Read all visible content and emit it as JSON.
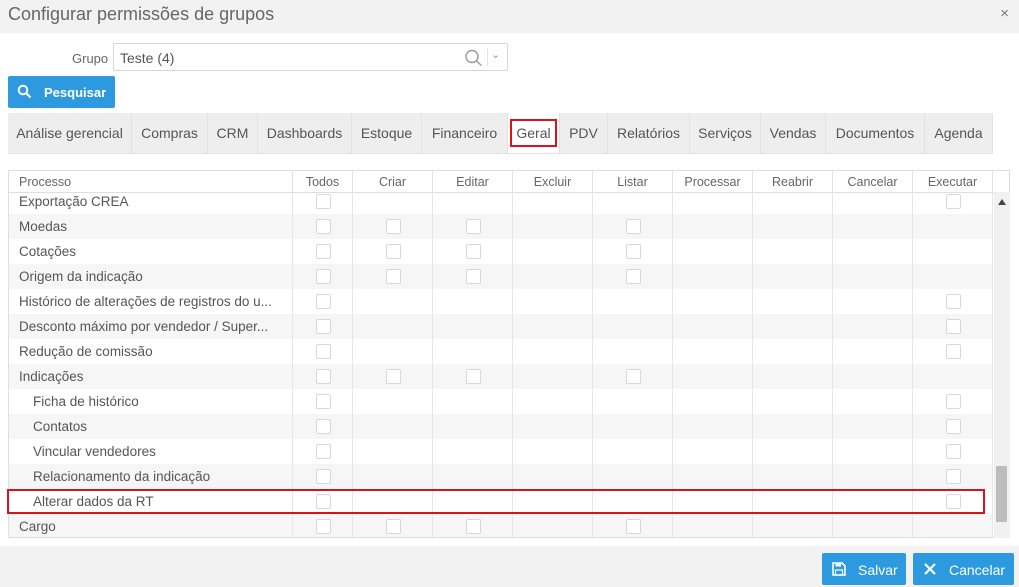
{
  "window": {
    "title": "Configurar permissões de grupos",
    "close_glyph": "×"
  },
  "group": {
    "label": "Grupo",
    "value": "Teste (4)"
  },
  "search_button": {
    "label": "Pesquisar"
  },
  "tabs": [
    {
      "label": "Análise gerencial"
    },
    {
      "label": "Compras"
    },
    {
      "label": "CRM"
    },
    {
      "label": "Dashboards"
    },
    {
      "label": "Estoque"
    },
    {
      "label": "Financeiro"
    },
    {
      "label": "Geral",
      "active": true
    },
    {
      "label": "PDV"
    },
    {
      "label": "Relatórios"
    },
    {
      "label": "Serviços"
    },
    {
      "label": "Vendas"
    },
    {
      "label": "Documentos"
    },
    {
      "label": "Agenda"
    }
  ],
  "table": {
    "columns": [
      "Processo",
      "Todos",
      "Criar",
      "Editar",
      "Excluir",
      "Listar",
      "Processar",
      "Reabrir",
      "Cancelar",
      "Executar"
    ],
    "rows": [
      {
        "name": "Exportação CREA",
        "indent": false,
        "checks": [
          1,
          0,
          0,
          0,
          0,
          0,
          0,
          0,
          1
        ]
      },
      {
        "name": "Moedas",
        "indent": false,
        "checks": [
          1,
          1,
          1,
          0,
          1,
          0,
          0,
          0,
          0
        ]
      },
      {
        "name": "Cotações",
        "indent": false,
        "checks": [
          1,
          1,
          1,
          0,
          1,
          0,
          0,
          0,
          0
        ]
      },
      {
        "name": "Origem da indicação",
        "indent": false,
        "checks": [
          1,
          1,
          1,
          0,
          1,
          0,
          0,
          0,
          0
        ]
      },
      {
        "name": "Histórico de alterações de registros do u...",
        "indent": false,
        "checks": [
          1,
          0,
          0,
          0,
          0,
          0,
          0,
          0,
          1
        ]
      },
      {
        "name": "Desconto máximo por vendedor / Super...",
        "indent": false,
        "checks": [
          1,
          0,
          0,
          0,
          0,
          0,
          0,
          0,
          1
        ]
      },
      {
        "name": "Redução de comissão",
        "indent": false,
        "checks": [
          1,
          0,
          0,
          0,
          0,
          0,
          0,
          0,
          1
        ]
      },
      {
        "name": "Indicações",
        "indent": false,
        "checks": [
          1,
          1,
          1,
          0,
          1,
          0,
          0,
          0,
          0
        ]
      },
      {
        "name": "Ficha de histórico",
        "indent": true,
        "checks": [
          1,
          0,
          0,
          0,
          0,
          0,
          0,
          0,
          1
        ]
      },
      {
        "name": "Contatos",
        "indent": true,
        "checks": [
          1,
          0,
          0,
          0,
          0,
          0,
          0,
          0,
          1
        ]
      },
      {
        "name": "Vincular vendedores",
        "indent": true,
        "checks": [
          1,
          0,
          0,
          0,
          0,
          0,
          0,
          0,
          1
        ]
      },
      {
        "name": "Relacionamento da indicação",
        "indent": true,
        "checks": [
          1,
          0,
          0,
          0,
          0,
          0,
          0,
          0,
          1
        ]
      },
      {
        "name": "Alterar dados da RT",
        "indent": true,
        "checks": [
          1,
          0,
          0,
          0,
          0,
          0,
          0,
          0,
          1
        ]
      },
      {
        "name": "Cargo",
        "indent": false,
        "checks": [
          1,
          1,
          1,
          0,
          1,
          0,
          0,
          0,
          0
        ]
      }
    ]
  },
  "footer": {
    "save_label": "Salvar",
    "cancel_label": "Cancelar"
  },
  "colors": {
    "accent": "#2d9ae0",
    "highlight": "#d9121c"
  }
}
